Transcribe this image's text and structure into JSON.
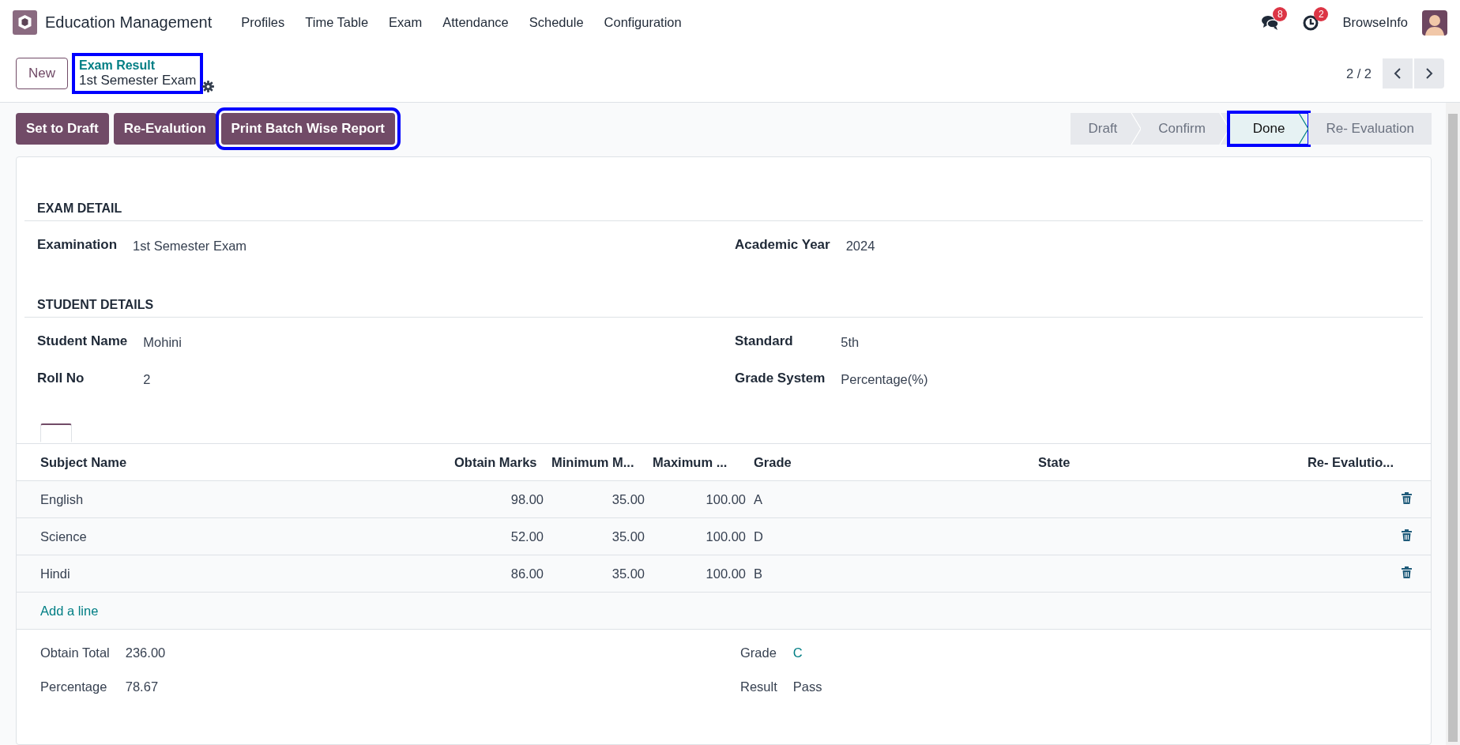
{
  "navbar": {
    "app_name": "Education Management",
    "menu": [
      "Profiles",
      "Time Table",
      "Exam",
      "Attendance",
      "Schedule",
      "Configuration"
    ],
    "messages_count": "8",
    "activities_count": "2",
    "user": "BrowseInfo"
  },
  "control_panel": {
    "new_button": "New",
    "breadcrumb": {
      "parent": "Exam Result",
      "current": "1st Semester Exam",
      "highlighted": true
    },
    "pager": "2 / 2"
  },
  "actions": [
    {
      "label": "Set to Draft",
      "highlighted": false
    },
    {
      "label": "Re-Evalution",
      "highlighted": false
    },
    {
      "label": "Print Batch Wise Report",
      "highlighted": true
    }
  ],
  "stages": [
    {
      "label": "Draft",
      "selected": false,
      "highlighted": false
    },
    {
      "label": "Confirm",
      "selected": false,
      "highlighted": false
    },
    {
      "label": "Done",
      "selected": true,
      "highlighted": true
    },
    {
      "label": "Re- Evaluation",
      "selected": false,
      "highlighted": false
    }
  ],
  "sections": [
    {
      "title": "EXAM DETAIL",
      "columns": [
        [
          {
            "label": "Examination",
            "value": "1st Semester Exam"
          }
        ],
        [
          {
            "label": "Academic Year",
            "value": "2024"
          }
        ]
      ]
    },
    {
      "title": "STUDENT DETAILS",
      "columns": [
        [
          {
            "label": "Student Name",
            "value": "Mohini"
          },
          {
            "label": "Roll No",
            "value": "2"
          }
        ],
        [
          {
            "label": "Standard",
            "value": "5th"
          },
          {
            "label": "Grade System",
            "value": "Percentage(%)"
          }
        ]
      ]
    }
  ],
  "table": {
    "columns": [
      "Subject Name",
      "Obtain Marks",
      "Minimum M...",
      "Maximum ...",
      "Grade",
      "State",
      "Re- Evalutio..."
    ],
    "rows": [
      {
        "cells": [
          "English",
          "98.00",
          "35.00",
          "100.00",
          "A"
        ]
      },
      {
        "cells": [
          "Science",
          "52.00",
          "35.00",
          "100.00",
          "D"
        ]
      },
      {
        "cells": [
          "Hindi",
          "86.00",
          "35.00",
          "100.00",
          "B"
        ]
      }
    ],
    "add_line": "Add a line"
  },
  "summary": {
    "columns": [
      [
        {
          "label": "Obtain Total",
          "value": "236.00",
          "kind": "text"
        },
        {
          "label": "Percentage",
          "value": "78.67",
          "kind": "text"
        }
      ],
      [
        {
          "label": "Grade",
          "value": "C",
          "kind": "link"
        },
        {
          "label": "Result",
          "value": "Pass",
          "kind": "text"
        }
      ]
    ]
  }
}
